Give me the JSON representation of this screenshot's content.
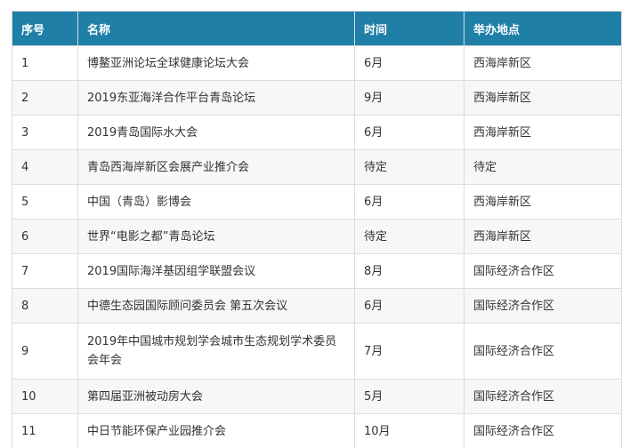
{
  "table": {
    "headers": [
      "序号",
      "名称",
      "时间",
      "举办地点"
    ],
    "rows": [
      {
        "no": "1",
        "name": "博鳌亚洲论坛全球健康论坛大会",
        "time": "6月",
        "place": "西海岸新区"
      },
      {
        "no": "2",
        "name": "2019东亚海洋合作平台青岛论坛",
        "time": "9月",
        "place": "西海岸新区"
      },
      {
        "no": "3",
        "name": "2019青岛国际水大会",
        "time": "6月",
        "place": "西海岸新区"
      },
      {
        "no": "4",
        "name": "青岛西海岸新区会展产业推介会",
        "time": "待定",
        "place": "待定"
      },
      {
        "no": "5",
        "name": "中国（青岛）影博会",
        "time": "6月",
        "place": "西海岸新区"
      },
      {
        "no": "6",
        "name": "世界“电影之都”青岛论坛",
        "time": "待定",
        "place": "西海岸新区"
      },
      {
        "no": "7",
        "name": "2019国际海洋基因组学联盟会议",
        "time": "8月",
        "place": "国际经济合作区"
      },
      {
        "no": "8",
        "name": "中德生态园国际顾问委员会 第五次会议",
        "time": "6月",
        "place": "国际经济合作区"
      },
      {
        "no": "9",
        "name": "2019年中国城市规划学会城市生态规划学术委员会年会",
        "time": "7月",
        "place": "国际经济合作区"
      },
      {
        "no": "10",
        "name": "第四届亚洲被动房大会",
        "time": "5月",
        "place": "国际经济合作区"
      },
      {
        "no": "11",
        "name": "中日节能环保产业园推介会",
        "time": "10月",
        "place": "国际经济合作区"
      }
    ]
  }
}
